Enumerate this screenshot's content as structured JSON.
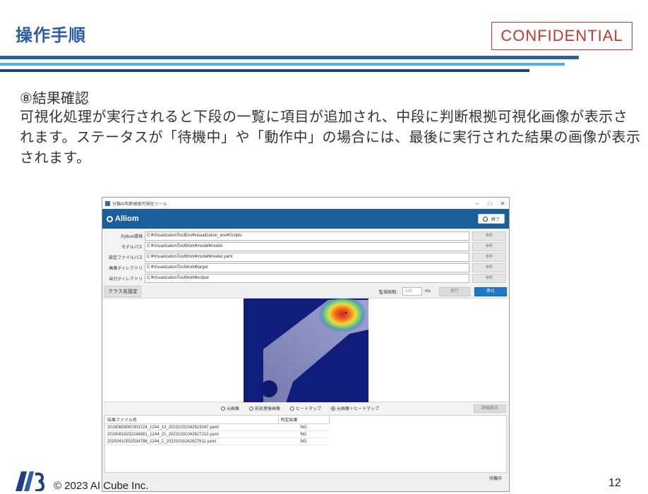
{
  "slide": {
    "title": "操作手順",
    "confidential": "CONFIDENTIAL",
    "step_heading": "⑧結果確認",
    "description": "可視化処理が実行されると下段の一覧に項目が追加され、中段に判断根拠可視化画像が表示されます。ステータスが「待機中」や「動作中」の場合には、最後に実行された結果の画像が表示されます。",
    "copyright": "© 2023 AI Cube Inc.",
    "page_number": "12",
    "rule_colors": [
      "#2f5fa7",
      "#4fb1e0",
      "#1f3f83"
    ]
  },
  "app": {
    "window_title": "分類AI判断根拠可視化ツール",
    "window_controls": [
      "–",
      "□",
      "✕"
    ],
    "brand": "Alliom",
    "exit_label": "終了",
    "paths": [
      {
        "label": "Python環境",
        "value": "C:¥VisualizationToolEnv¥visualization_env¥Scripts",
        "button": "参照"
      },
      {
        "label": "モデルパス",
        "value": "C:¥VisualizationToolWork¥model¥model",
        "button": "参照"
      },
      {
        "label": "設定ファイルパス",
        "value": "C:¥VisualizationToolWork¥model¥model.yaml",
        "button": "参照"
      },
      {
        "label": "画像ディレクトリ",
        "value": "C:¥VisualizationToolWork¥target",
        "button": "参照"
      },
      {
        "label": "出力ディレクトリ",
        "value": "C:¥VisualizationToolWork¥output",
        "button": "参照"
      }
    ],
    "class_button": "クラス名設定",
    "interval_label": "監視周期：",
    "interval_value": "100",
    "interval_unit": "ms",
    "run_button": "実行",
    "stop_button": "停止",
    "view_modes": [
      {
        "label": "元画像",
        "selected": false
      },
      {
        "label": "前処理後画像",
        "selected": false
      },
      {
        "label": "ヒートマップ",
        "selected": false
      },
      {
        "label": "元画像＋ヒートマップ",
        "selected": true
      }
    ],
    "detail_button": "詳細表示",
    "results": {
      "columns": [
        "結果ファイル名",
        "判定結果"
      ],
      "rows": [
        [
          "20190809000303724_1244_13_20231031042623047.yaml",
          "NG"
        ],
        [
          "20190816232244581_1244_21_20231031042627212.yaml",
          "NG"
        ],
        [
          "20200410032534788_1244_2_20231031042627611.yaml",
          "NG"
        ]
      ]
    },
    "status": "待機中",
    "accent_color": "#1b5e9e"
  }
}
